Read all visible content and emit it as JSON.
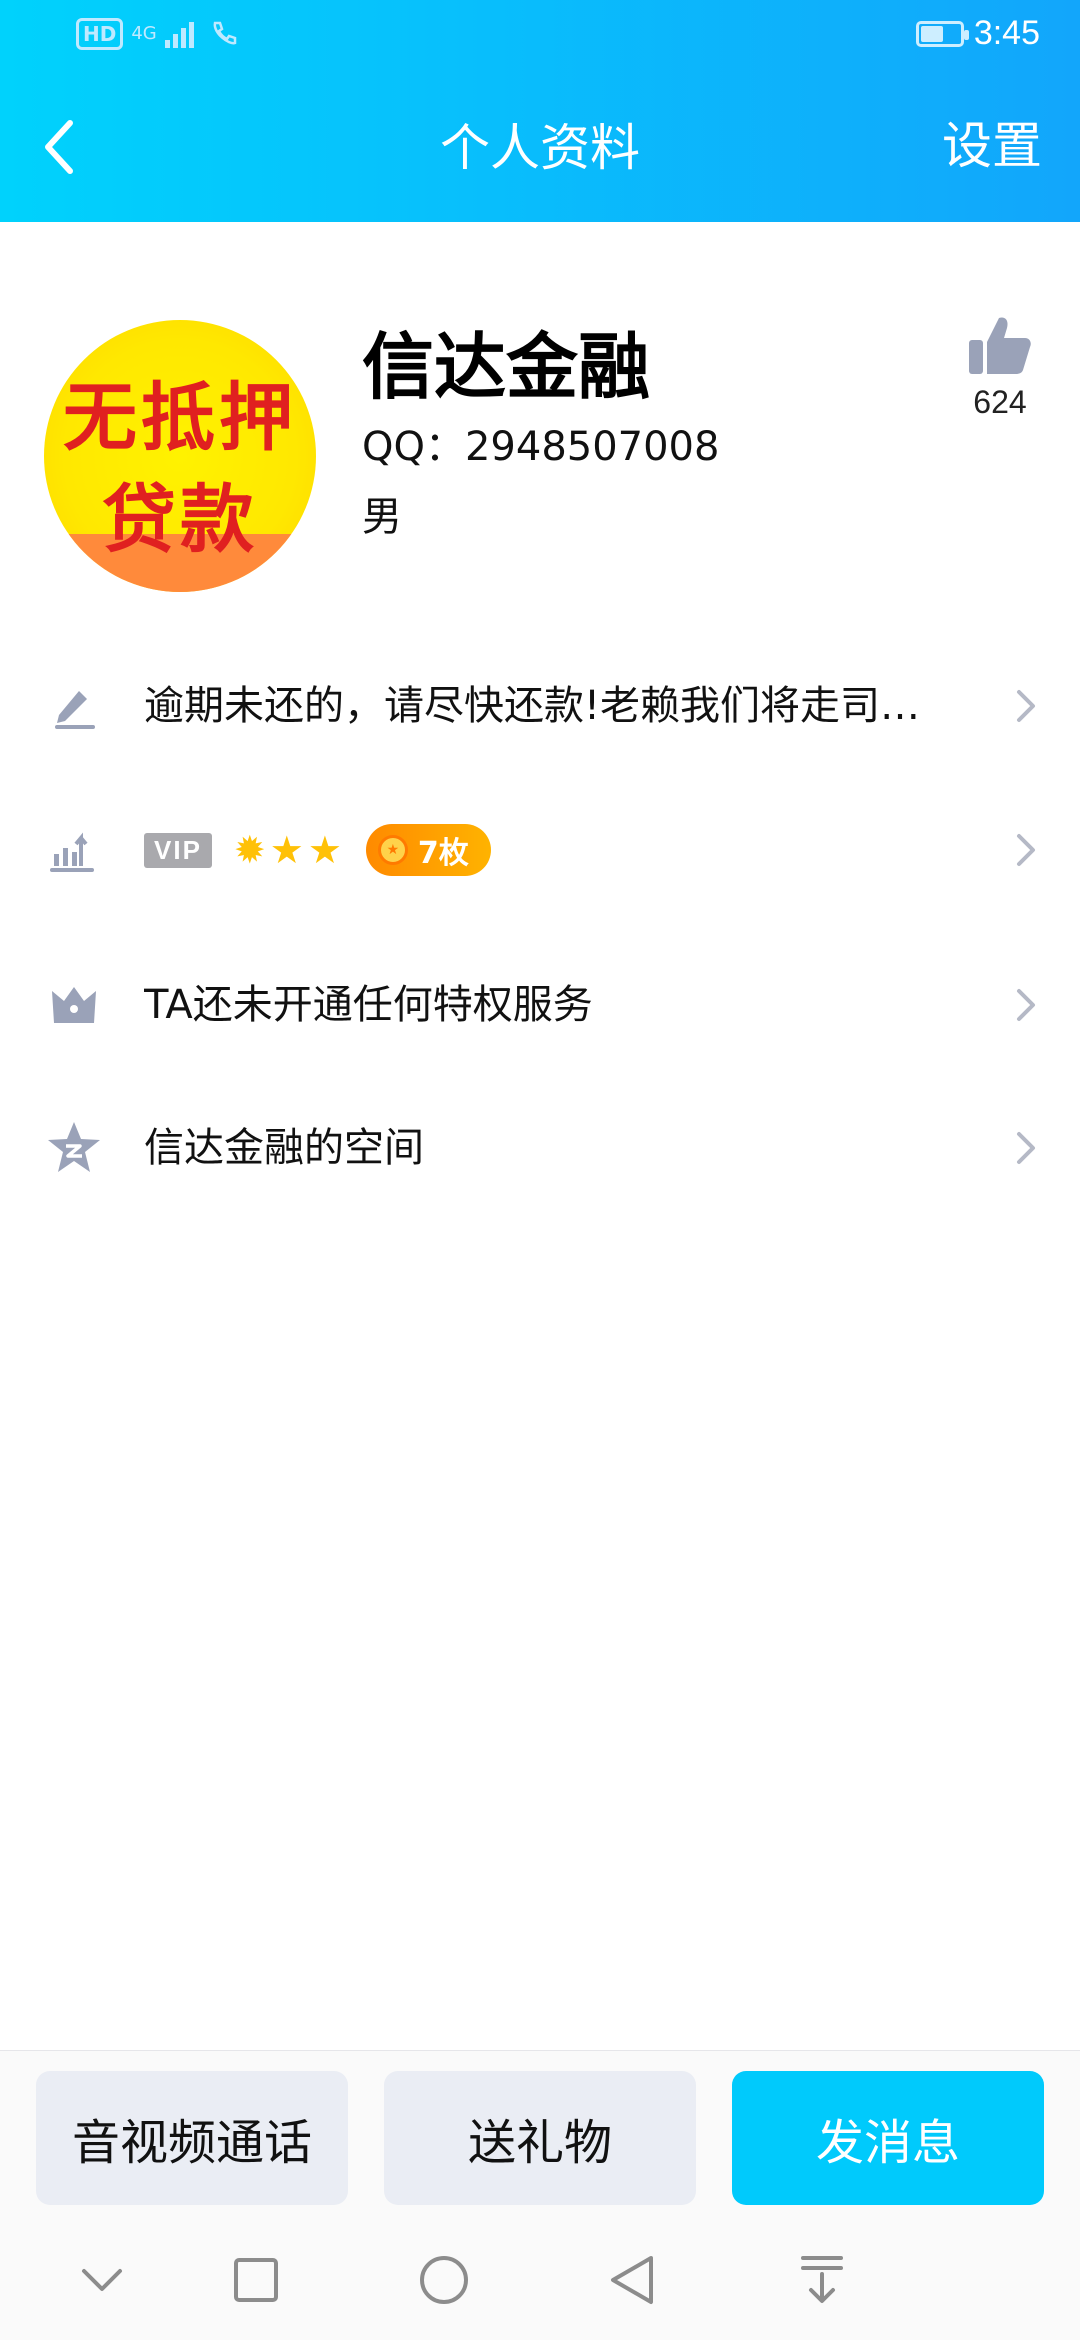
{
  "status_bar": {
    "hd": "HD",
    "network": "4G",
    "time": "3:45"
  },
  "header": {
    "title": "个人资料",
    "settings_label": "设置"
  },
  "profile": {
    "avatar_text_line1": "无抵押",
    "avatar_text_line2": "贷款",
    "nickname": "信达金融",
    "qq": "QQ：2948507008",
    "gender": "男",
    "likes": "624"
  },
  "rows": {
    "signature": "逾期未还的，请尽快还款!老赖我们将走司法途径",
    "vip_tag": "VIP",
    "medal_count": "7枚",
    "privilege": "TA还未开通任何特权服务",
    "qzone": "信达金融的空间"
  },
  "actions": {
    "call": "音视频通话",
    "gift": "送礼物",
    "message": "发消息"
  },
  "colors": {
    "header_start": "#00d2fc",
    "header_end": "#12a6fb",
    "primary": "#00cafc",
    "icon_gray": "#9aa2b8"
  }
}
